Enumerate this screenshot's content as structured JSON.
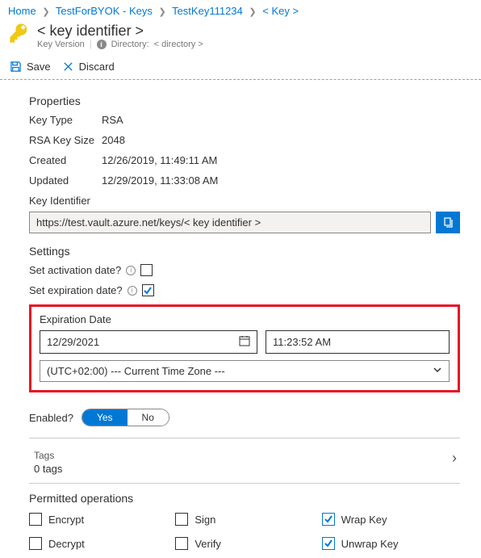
{
  "breadcrumb": {
    "home": "Home",
    "vault": "TestForBYOK - Keys",
    "key": "TestKey111234",
    "version": "< Key >"
  },
  "header": {
    "title": "< key identifier >",
    "subtitle_left": "Key Version",
    "subtitle_dir_label": "Directory:",
    "subtitle_dir_value": "< directory >"
  },
  "toolbar": {
    "save": "Save",
    "discard": "Discard"
  },
  "properties": {
    "heading": "Properties",
    "keytype_label": "Key Type",
    "keytype_value": "RSA",
    "keysize_label": "RSA Key Size",
    "keysize_value": "2048",
    "created_label": "Created",
    "created_value": "12/26/2019, 11:49:11 AM",
    "updated_label": "Updated",
    "updated_value": "12/29/2019, 11:33:08 AM",
    "keyid_label": "Key Identifier",
    "keyid_value": "https://test.vault.azure.net/keys/< key identifier >"
  },
  "settings": {
    "heading": "Settings",
    "activation_label": "Set activation date?",
    "expiration_label": "Set expiration date?",
    "exp_heading": "Expiration Date",
    "exp_date": "12/29/2021",
    "exp_time": "11:23:52 AM",
    "timezone": "(UTC+02:00) --- Current Time Zone ---",
    "enabled_label": "Enabled?",
    "yes": "Yes",
    "no": "No"
  },
  "tags": {
    "label": "Tags",
    "count": "0 tags"
  },
  "ops": {
    "heading": "Permitted operations",
    "encrypt": "Encrypt",
    "sign": "Sign",
    "wrap": "Wrap Key",
    "decrypt": "Decrypt",
    "verify": "Verify",
    "unwrap": "Unwrap Key"
  }
}
